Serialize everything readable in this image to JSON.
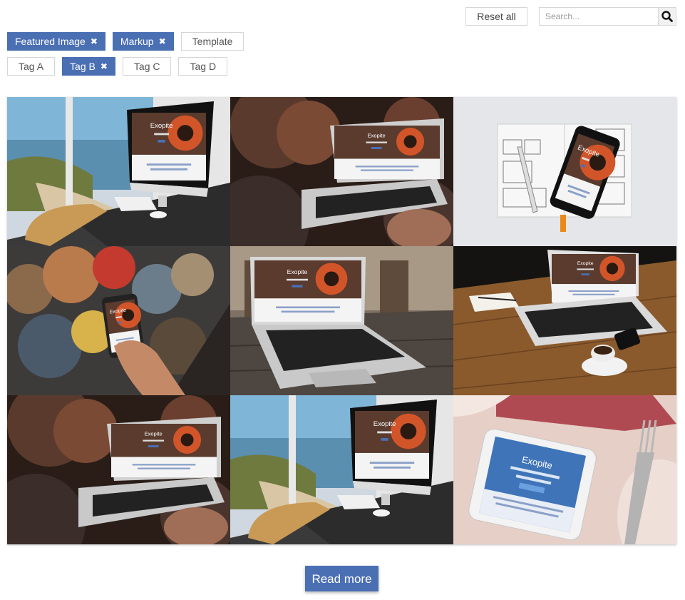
{
  "toolbar": {
    "reset_label": "Reset all",
    "search_placeholder": "Search..."
  },
  "filters_row1": [
    {
      "label": "Featured Image",
      "active": true
    },
    {
      "label": "Markup",
      "active": true
    },
    {
      "label": "Template",
      "active": false
    }
  ],
  "filters_row2": [
    {
      "label": "Tag A",
      "active": false
    },
    {
      "label": "Tag B",
      "active": true
    },
    {
      "label": "Tag C",
      "active": false
    },
    {
      "label": "Tag D",
      "active": false
    }
  ],
  "gallery": [
    {
      "scene": "imac-window"
    },
    {
      "scene": "laptop-hands"
    },
    {
      "scene": "phone-notebook"
    },
    {
      "scene": "phone-crowd"
    },
    {
      "scene": "laptop-table"
    },
    {
      "scene": "laptop-wood"
    },
    {
      "scene": "laptop-hands"
    },
    {
      "scene": "imac-window"
    },
    {
      "scene": "phone-fork"
    }
  ],
  "screen_text": {
    "brand": "Exopite"
  },
  "read_more_label": "Read more",
  "colors": {
    "accent": "#4a6fb3",
    "screen_orange": "#d2552a"
  }
}
